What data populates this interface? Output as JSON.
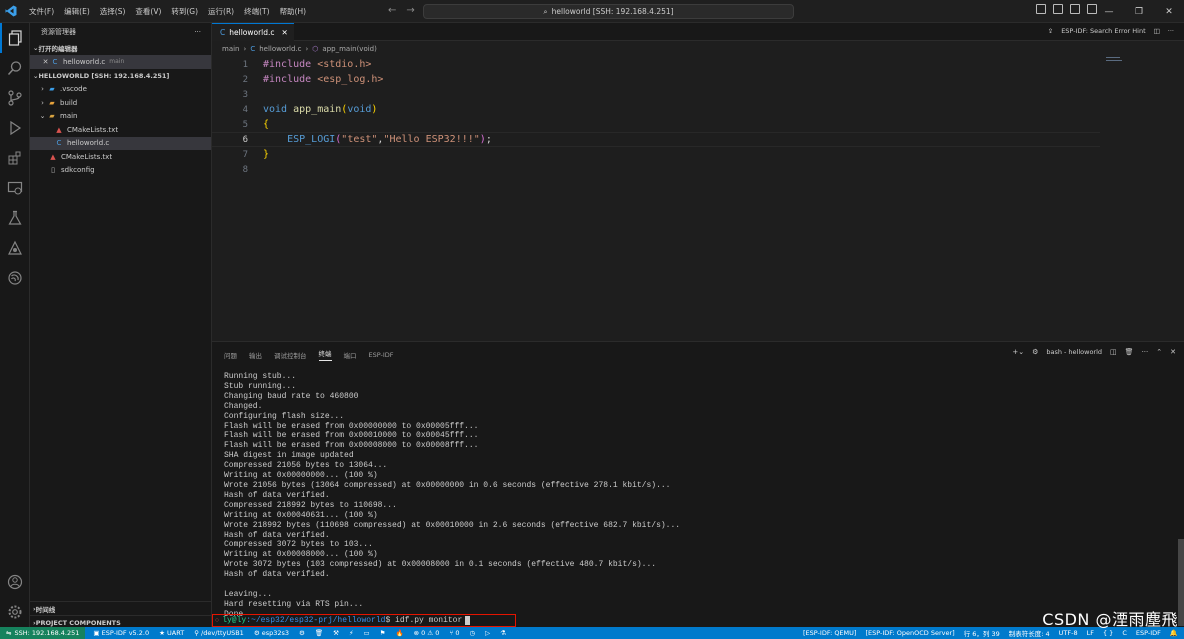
{
  "titlebar": {
    "menu": [
      "文件(F)",
      "编辑(E)",
      "选择(S)",
      "查看(V)",
      "转到(G)",
      "运行(R)",
      "终端(T)",
      "帮助(H)"
    ],
    "command_center": "helloworld [SSH: 192.168.4.251]",
    "accent": "#0078d4"
  },
  "sidebar": {
    "title": "资源管理器",
    "open_editors_label": "打开的编辑器",
    "open_editor_file": "helloworld.c",
    "open_editor_dir": "main",
    "workspace_label": "HELLOWORLD [SSH: 192.168.4.251]",
    "tree": [
      {
        "name": ".vscode",
        "kind": "folder",
        "depth": 1
      },
      {
        "name": "build",
        "kind": "folder",
        "depth": 1
      },
      {
        "name": "main",
        "kind": "folder-open",
        "depth": 1
      },
      {
        "name": "CMakeLists.txt",
        "kind": "cmake",
        "depth": 2
      },
      {
        "name": "helloworld.c",
        "kind": "c",
        "depth": 2
      },
      {
        "name": "CMakeLists.txt",
        "kind": "cmake",
        "depth": 1
      },
      {
        "name": "sdkconfig",
        "kind": "file",
        "depth": 1
      }
    ],
    "timeline_label": "时间线",
    "project_components_label": "PROJECT COMPONENTS"
  },
  "editor": {
    "tab_label": "helloworld.c",
    "hint": "ESP-IDF: Search Error Hint",
    "breadcrumb": [
      "main",
      "helloworld.c",
      "app_main(void)"
    ],
    "line_numbers": [
      "1",
      "2",
      "3",
      "4",
      "5",
      "6",
      "7",
      "8"
    ],
    "lines": {
      "l1a": "#include",
      "l1b": "<stdio.h>",
      "l2a": "#include",
      "l2b": "<esp_log.h>",
      "l4a": "void",
      "l4b": "app_main",
      "l4c": "(",
      "l4d": "void",
      "l4e": ")",
      "l5": "{",
      "l6a": "ESP_LOGI",
      "l6b": "(",
      "l6c": "\"test\"",
      "l6d": ",",
      "l6e": "\"Hello ESP32!!!\"",
      "l6f": ")",
      "l6g": ";",
      "l7": "}"
    }
  },
  "panel": {
    "tabs": [
      "问题",
      "输出",
      "调试控制台",
      "终端",
      "端口",
      "ESP-IDF"
    ],
    "active_tab": "终端",
    "terminal_name": "bash - helloworld",
    "output": [
      "Running stub...",
      "Stub running...",
      "Changing baud rate to 460800",
      "Changed.",
      "Configuring flash size...",
      "Flash will be erased from 0x00000000 to 0x00005fff...",
      "Flash will be erased from 0x00010000 to 0x00045fff...",
      "Flash will be erased from 0x00008000 to 0x00008fff...",
      "SHA digest in image updated",
      "Compressed 21056 bytes to 13064...",
      "Writing at 0x00000000... (100 %)",
      "Wrote 21056 bytes (13064 compressed) at 0x00000000 in 0.6 seconds (effective 278.1 kbit/s)...",
      "Hash of data verified.",
      "Compressed 218992 bytes to 110698...",
      "Writing at 0x00040631... (100 %)",
      "Wrote 218992 bytes (110698 compressed) at 0x00010000 in 2.6 seconds (effective 682.7 kbit/s)...",
      "Hash of data verified.",
      "Compressed 3072 bytes to 103...",
      "Writing at 0x00008000... (100 %)",
      "Wrote 3072 bytes (103 compressed) at 0x00008000 in 0.1 seconds (effective 480.7 kbit/s)...",
      "Hash of data verified.",
      "",
      "Leaving...",
      "Hard resetting via RTS pin...",
      "Done"
    ],
    "prompt_user": "ly@ly",
    "prompt_path": ":~/esp32/esp32-prj/helloworld",
    "prompt_cmd": "$ idf.py monitor"
  },
  "statusbar": {
    "remote": "SSH: 192.168.4.251",
    "idf_version": "ESP-IDF v5.2.0",
    "flash_method": "UART",
    "port": "/dev/ttyUSB1",
    "target": "esp32s3",
    "problems": "0",
    "warnings": "0",
    "ports": "0",
    "qemu": "[ESP-IDF: QEMU]",
    "openocd": "[ESP-IDF: OpenOCD Server]",
    "cursor_pos": "行 6，列 39",
    "indent": "制表符长度: 4",
    "encoding": "UTF-8",
    "eol": "LF",
    "braces": "{ }",
    "language": "C",
    "idf_label": "ESP-IDF"
  },
  "watermark": "CSDN @湮雨塵飛"
}
